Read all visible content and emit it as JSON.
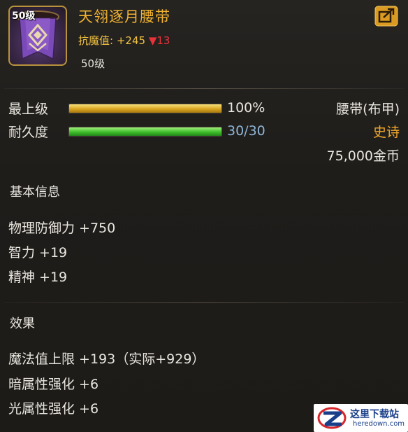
{
  "item": {
    "icon": "purple-belt-icon",
    "level_badge": "50级",
    "name": "天翎逐月腰带",
    "stat_label": "抗魔值:",
    "stat_value": "+245",
    "stat_diff_arrow": "▼",
    "stat_diff": "13",
    "required_level": "50级"
  },
  "bars": {
    "top_level": {
      "label": "最上级",
      "percent": 100,
      "text": "100%"
    },
    "durability": {
      "label": "耐久度",
      "current": 30,
      "max": 30,
      "text": "30/30"
    }
  },
  "meta": {
    "type": "腰带(布甲)",
    "rarity": "史诗",
    "price": "75,000金币"
  },
  "basic": {
    "title": "基本信息",
    "attrs": [
      "物理防御力 +750",
      "智力 +19",
      "精神 +19"
    ]
  },
  "effects": {
    "title": "效果",
    "attrs": [
      "魔法值上限 +193（实际+929）",
      "暗属性强化 +6",
      "光属性强化 +6"
    ]
  },
  "watermark": {
    "cn": "这里下载站",
    "en": "heredown.com"
  },
  "colors": {
    "name": "#f2b431",
    "rarity": "#f0a82e",
    "diff": "#e8323a",
    "durability_text": "#8fb6d8"
  }
}
